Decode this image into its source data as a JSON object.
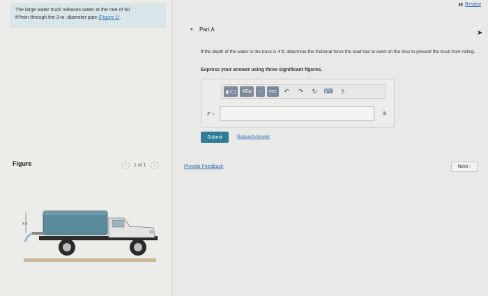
{
  "problem": {
    "line1": "The large water truck releases water at the rate of 60",
    "line2_unit": "ft³/min through the 3-in.-diameter pipe",
    "link": "(Figure 1)",
    "period": "."
  },
  "figure": {
    "label": "Figure",
    "pager_text": "1 of 1",
    "prev_glyph": "<",
    "next_glyph": ">",
    "depth_label": "4 ft"
  },
  "header": {
    "review_icon": "▮▮",
    "review_label": "Review"
  },
  "part": {
    "caret": "▼",
    "title": "Part A",
    "question": "If the depth of the water in the truck is 4 ft, determine the frictional force the road has to exert on the tires to prevent the truck from rolling.",
    "instruction": "Express your answer using three significant figures."
  },
  "toolbar": {
    "template_btn": "▮√▢",
    "greek_btn": "ΑΣφ",
    "arrows_btn": "↓↑",
    "vec_btn": "vec",
    "undo_icon": "↶",
    "redo_icon": "↷",
    "reset_icon": "↻",
    "keyboard_icon": "⌨",
    "help_icon": "?"
  },
  "answer": {
    "var_label": "F =",
    "value": "",
    "unit": "lb"
  },
  "actions": {
    "submit": "Submit",
    "request": "Request Answer",
    "feedback": "Provide Feedback",
    "next": "Next ›"
  },
  "colors": {
    "submit_bg": "#2e7c97",
    "link": "#2a6fb5",
    "problem_bg": "#d9e6e9",
    "toolbar_btn": "#7c8a9c"
  }
}
